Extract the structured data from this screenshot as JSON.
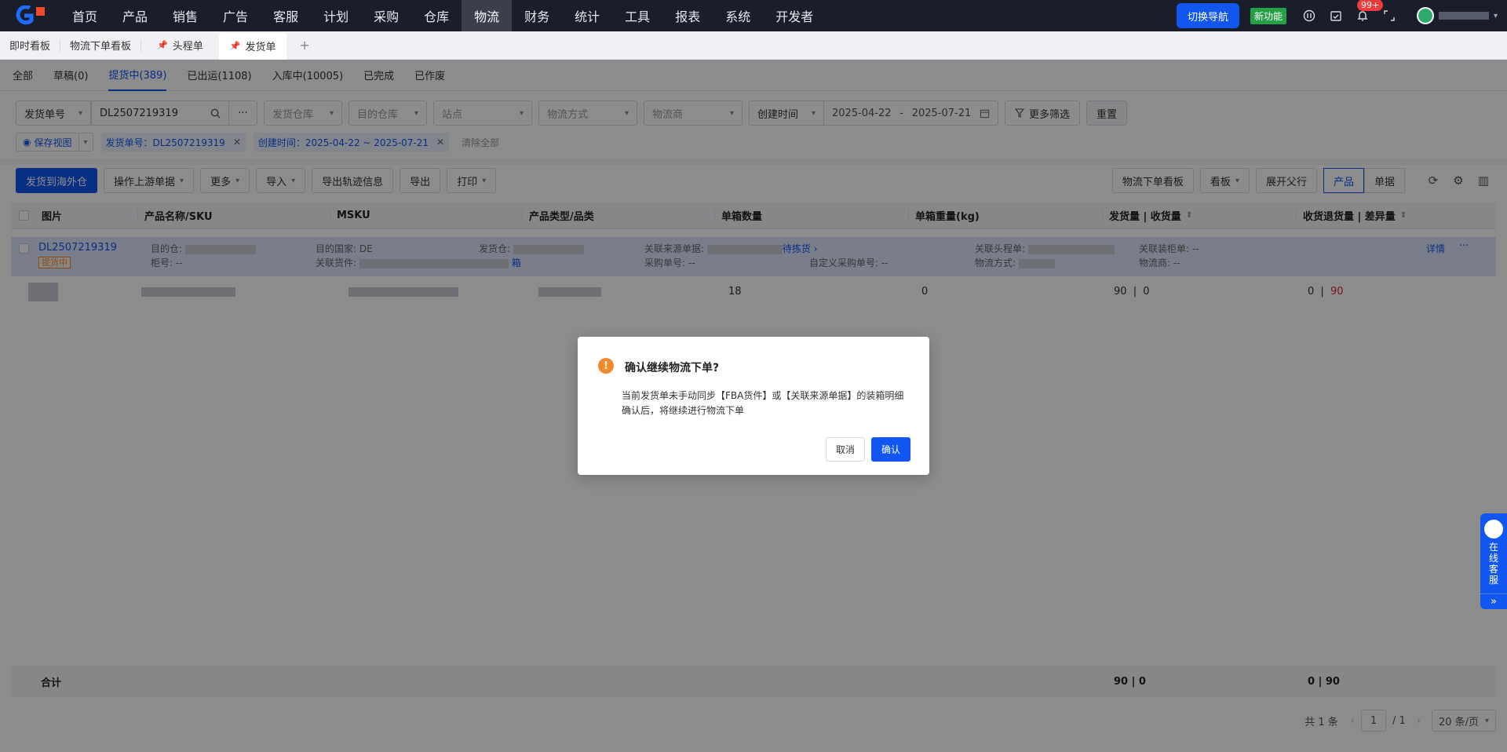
{
  "nav": {
    "items": [
      "首页",
      "产品",
      "销售",
      "广告",
      "客服",
      "计划",
      "采购",
      "仓库",
      "物流",
      "财务",
      "统计",
      "工具",
      "报表",
      "系统",
      "开发者"
    ],
    "active_index": 8,
    "switch_nav": "切换导航",
    "new_func": "新功能",
    "notif_badge": "99+"
  },
  "pagetabs": {
    "pinned": [
      "即时看板",
      "物流下单看板"
    ],
    "tabs": [
      "头程单",
      "发货单"
    ],
    "active": "发货单",
    "add": "+"
  },
  "status_tabs": [
    "全部",
    "草稿(0)",
    "提货中(389)",
    "已出运(1108)",
    "入库中(10005)",
    "已完成",
    "已作废"
  ],
  "filters": {
    "field_select": "发货单号",
    "search_value": "DL2507219319",
    "more_icon": "···",
    "ship_wh": "发货仓库",
    "dest_wh": "目的仓库",
    "site": "站点",
    "method": "物流方式",
    "carrier": "物流商",
    "date_field": "创建时间",
    "date_from": "2025-04-22",
    "date_sep": "-",
    "date_to": "2025-07-21",
    "more_filter": "更多筛选",
    "reset": "重置"
  },
  "tags": {
    "save_view": "保存视图",
    "tag1": "发货单号：DL2507219319",
    "tag2": "创建时间：2025-04-22 ~ 2025-07-21",
    "clear_all": "清除全部"
  },
  "toolbar": {
    "ship_overseas": "发货到海外仓",
    "upstream": "操作上游单据",
    "more": "更多",
    "import": "导入",
    "export_track": "导出轨迹信息",
    "export": "导出",
    "print": "打印",
    "board_order": "物流下单看板",
    "board": "看板",
    "expand": "展开父行",
    "product": "产品",
    "doc": "单据"
  },
  "table": {
    "headers": [
      "图片",
      "产品名称/SKU",
      "MSKU",
      "产品类型/品类",
      "单箱数量",
      "单箱重量(kg)",
      "发货量 | 收货量",
      "收货退货量 | 差异量"
    ],
    "group": {
      "order_no": "DL2507219319",
      "status": "提货中",
      "dest_wh_label": "目的仓:",
      "cabinet_label": "柜号: --",
      "dest_country": "目的国家: DE",
      "linked_goods": "关联货件:",
      "ship_wh_label": "发货仓:",
      "box_link": "箱",
      "src_doc": "关联来源单据:",
      "pick_link": "待拣货 ›",
      "po": "采购单号: --",
      "custom_po": "自定义采购单号: --",
      "head_doc": "关联头程单:",
      "logi_method": "物流方式:",
      "box_list": "关联装柜单: --",
      "carrier": "物流商: --",
      "detail": "详情",
      "more": "···"
    },
    "row": {
      "qty_per_box": "18",
      "weight_per_box": "0",
      "ship_qty": "90",
      "sep": "|",
      "recv_qty": "0",
      "return_qty": "0",
      "diff_qty": "90"
    },
    "summary": {
      "label": "合计",
      "ship_recv": "90 | 0",
      "return_diff": "0 | 90"
    }
  },
  "pager": {
    "total": "共 1 条",
    "prev": "‹",
    "page": "1",
    "of": "/ 1",
    "next": "›",
    "size": "20 条/页"
  },
  "modal": {
    "title": "确认继续物流下单?",
    "line1": "当前发货单未手动同步【FBA货件】或【关联来源单据】的装箱明细",
    "line2": "确认后，将继续进行物流下单",
    "cancel": "取消",
    "ok": "确认"
  },
  "cs": {
    "text": "在线客服",
    "arrow": "»"
  },
  "colors": {
    "primary": "#1256f0",
    "nav_bg": "#1a1e2b",
    "warn": "#f28a2c"
  }
}
